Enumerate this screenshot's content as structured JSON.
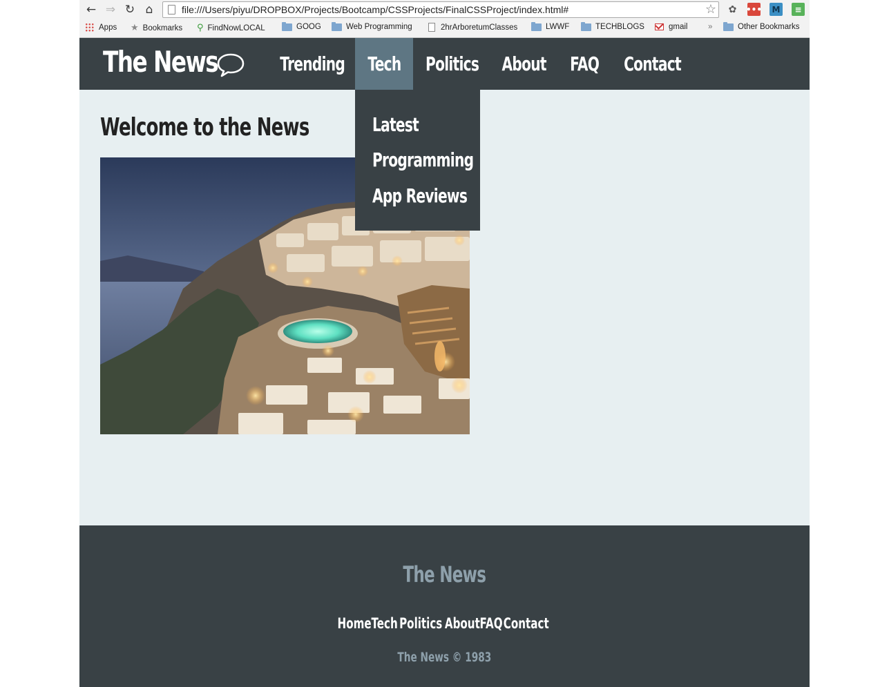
{
  "browser": {
    "url": "file:///Users/piyu/DROPBOX/Projects/Bootcamp/CSSProjects/FinalCSSProject/index.html#",
    "bookmarks": [
      {
        "label": "Apps",
        "icon": "apps-icon"
      },
      {
        "label": "Bookmarks",
        "icon": "star-icon"
      },
      {
        "label": "FindNowLOCAL",
        "icon": "search-icon"
      },
      {
        "label": "GOOG",
        "icon": "folder-icon"
      },
      {
        "label": "Web Programming",
        "icon": "folder-icon"
      },
      {
        "label": "2hrArboretumClasses",
        "icon": "page-icon"
      },
      {
        "label": "LWWF",
        "icon": "folder-icon"
      },
      {
        "label": "TECHBLOGS",
        "icon": "folder-icon"
      },
      {
        "label": "gmail",
        "icon": "gmail-icon"
      }
    ],
    "overflow_label": "»",
    "other_bookmarks": "Other Bookmarks",
    "extensions": [
      {
        "icon": "evernote-icon",
        "label": ""
      },
      {
        "icon": "lastpass-icon",
        "label": "•••"
      },
      {
        "icon": "m-extension-icon",
        "label": "M"
      },
      {
        "icon": "feed-icon",
        "label": "≡"
      }
    ]
  },
  "site": {
    "brand": "The News",
    "nav": [
      {
        "label": "Trending",
        "active": false
      },
      {
        "label": "Tech",
        "active": true
      },
      {
        "label": "Politics",
        "active": false
      },
      {
        "label": "About",
        "active": false
      },
      {
        "label": "FAQ",
        "active": false
      },
      {
        "label": "Contact",
        "active": false
      }
    ],
    "dropdown": [
      "Latest",
      "Programming",
      "App Reviews"
    ],
    "heading": "Welcome to the News",
    "footer": {
      "brand": "The News",
      "links": [
        "Home",
        "Tech",
        "Politics",
        "About",
        "FAQ",
        "Contact"
      ],
      "copyright": "The News © 1983"
    }
  },
  "colors": {
    "header_bg": "#394145",
    "active_tab_bg": "#5e7683",
    "page_bg": "#e7eff1",
    "footer_muted_text": "#8ea0ab"
  }
}
